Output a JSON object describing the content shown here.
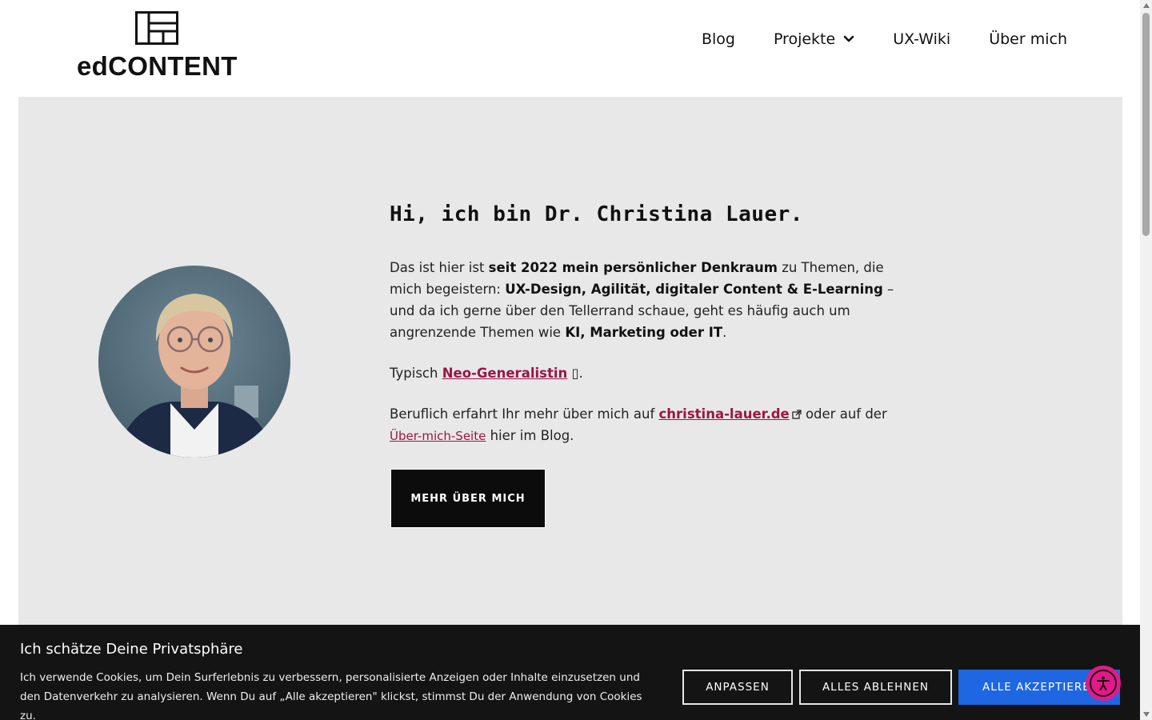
{
  "header": {
    "logo_text": "edCONTENT",
    "nav": [
      {
        "label": "Blog",
        "icon": null
      },
      {
        "label": "Projekte",
        "icon": "chevron-down-icon"
      },
      {
        "label": "UX-Wiki",
        "icon": null
      },
      {
        "label": "Über mich",
        "icon": null
      }
    ]
  },
  "hero": {
    "title": "Hi, ich bin Dr. Christina Lauer.",
    "intro": {
      "p1_a": "Das ist hier ist ",
      "p1_b": "seit 2022 mein persönlicher Denkraum",
      "p1_c": " zu Themen, die mich begeistern: ",
      "p1_d": "UX-Design, Agilität, digitaler Content & E-Learning",
      "p1_e": " – und da ich gerne über den Tellerrand schaue, geht es häufig auch um angrenzende Themen wie ",
      "p1_f": "KI, Marketing oder IT",
      "p1_g": "."
    },
    "typical": {
      "prefix": "Typisch ",
      "link": "Neo-Generalistin",
      "suffix": " ▯."
    },
    "career": {
      "prefix": "Beruflich erfahrt Ihr mehr über mich auf ",
      "link1": "christina-lauer.de",
      "middle": " oder auf der ",
      "link2": "Über-mich-Seite",
      "suffix": " hier im Blog."
    },
    "cta_label": "MEHR ÜBER MICH",
    "link_color": "#9b1646",
    "background": "#e8e8e8"
  },
  "cookie": {
    "title": "Ich schätze Deine Privatsphäre",
    "text": "Ich verwende Cookies, um Dein Surferlebnis zu verbessern, personalisierte Anzeigen oder Inhalte einzusetzen und den Datenverkehr zu analysieren. Wenn Du auf „Alle akzeptieren\" klickst, stimmst Du der Anwendung von Cookies zu.",
    "buttons": {
      "customize": "ANPASSEN",
      "reject": "ALLES ABLEHNEN",
      "accept": "ALLE AKZEPTIEREN"
    },
    "accept_color": "#1e66e2"
  },
  "accessibility": {
    "icon": "accessibility-icon",
    "color": "#e5188a"
  }
}
